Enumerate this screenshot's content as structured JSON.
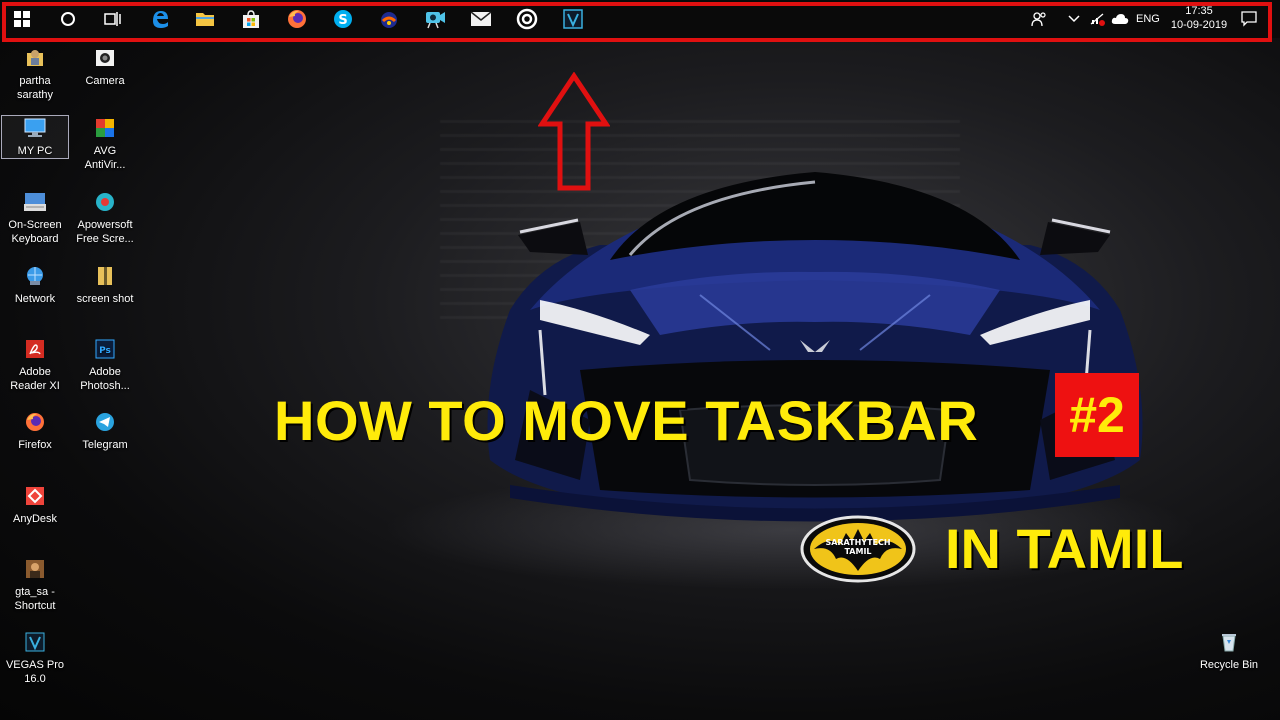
{
  "taskbar": {
    "buttons": [
      {
        "name": "start",
        "icon": "windows-logo-icon"
      },
      {
        "name": "search",
        "icon": "cortana-circle-icon"
      },
      {
        "name": "task-view",
        "icon": "task-view-icon"
      },
      {
        "name": "edge",
        "icon": "edge-icon"
      },
      {
        "name": "file-explorer",
        "icon": "folder-icon"
      },
      {
        "name": "store",
        "icon": "store-bag-icon"
      },
      {
        "name": "firefox",
        "icon": "firefox-icon"
      },
      {
        "name": "skype",
        "icon": "skype-icon"
      },
      {
        "name": "media",
        "icon": "media-app-icon"
      },
      {
        "name": "video-camera",
        "icon": "video-camera-icon"
      },
      {
        "name": "mail",
        "icon": "mail-icon"
      },
      {
        "name": "target-app",
        "icon": "target-icon"
      },
      {
        "name": "vegas",
        "icon": "vegas-icon"
      }
    ],
    "tray": {
      "language": "ENG",
      "time": "17:35",
      "date": "10-09-2019"
    },
    "highlight_color": "#e01010"
  },
  "desktop": {
    "icons": [
      {
        "label": "partha\nsarathy",
        "icon": "user-folder-icon"
      },
      {
        "label": "Camera",
        "icon": "camera-icon"
      },
      {
        "label": "MY PC",
        "icon": "computer-icon"
      },
      {
        "label": "AVG\nAntiVir...",
        "icon": "avg-icon"
      },
      {
        "label": "On-Screen\nKeyboard",
        "icon": "keyboard-icon"
      },
      {
        "label": "Apowersoft\nFree Scre...",
        "icon": "recorder-icon"
      },
      {
        "label": "Network",
        "icon": "network-icon"
      },
      {
        "label": "screen shot",
        "icon": "zip-folder-icon"
      },
      {
        "label": "Adobe\nReader XI",
        "icon": "adobe-reader-icon"
      },
      {
        "label": "Adobe\nPhotosh...",
        "icon": "photoshop-icon"
      },
      {
        "label": "Firefox",
        "icon": "firefox-icon"
      },
      {
        "label": "Telegram",
        "icon": "telegram-icon"
      },
      {
        "label": "AnyDesk",
        "icon": "anydesk-icon"
      },
      {
        "label": "gta_sa -\nShortcut",
        "icon": "game-shortcut-icon"
      },
      {
        "label": "VEGAS Pro\n16.0",
        "icon": "vegas-icon"
      },
      {
        "label": "Recycle Bin",
        "icon": "recycle-bin-icon"
      }
    ]
  },
  "wallpaper": {
    "headline": "HOW TO MOVE TASKBAR",
    "badge": "#2",
    "subline": "IN TAMIL",
    "logo_text_1": "SARATHYTECH",
    "logo_text_2": "TAMIL",
    "headline_color": "#ffeb0a",
    "badge_color": "#ee1111"
  }
}
